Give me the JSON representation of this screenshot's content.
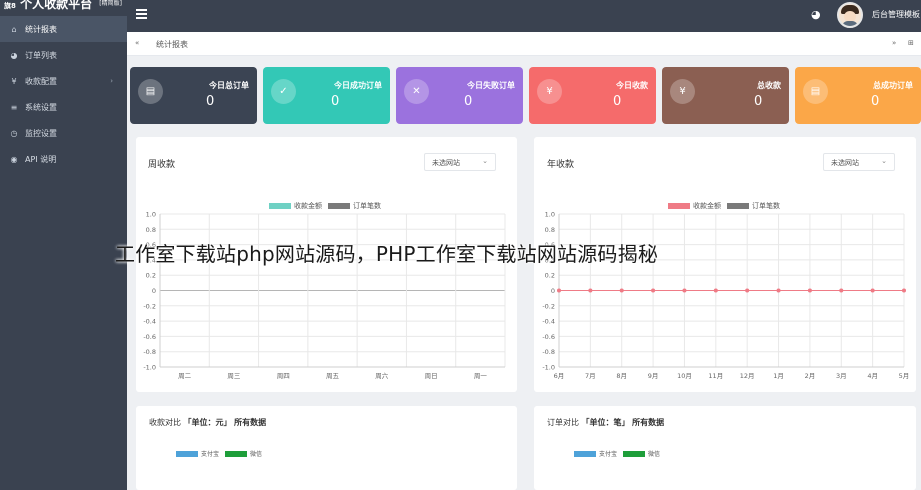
{
  "sidebar": {
    "brand": "个人收款平台",
    "brand_prefix": "旗8",
    "brand_tag": "[精简版]",
    "items": [
      {
        "label": "统计报表",
        "icon": "home-icon"
      },
      {
        "label": "订单列表",
        "icon": "palette-icon"
      },
      {
        "label": "收款配置",
        "icon": "yen-icon"
      },
      {
        "label": "系统设置",
        "icon": "list-icon"
      },
      {
        "label": "监控设置",
        "icon": "clock-icon"
      },
      {
        "label": "API 说明",
        "icon": "eye-icon"
      }
    ]
  },
  "topbar": {
    "user_name": "后台管理模板"
  },
  "tabbar": {
    "current_tab": "统计报表",
    "left_icon": "«",
    "right_icon": "»"
  },
  "cards": [
    {
      "title": "今日总订单",
      "value": "0",
      "color": "#3b4453",
      "icon": "file-icon",
      "glyph": "▤"
    },
    {
      "title": "今日成功订单",
      "value": "0",
      "color": "#33c8b6",
      "icon": "check-icon",
      "glyph": "✓"
    },
    {
      "title": "今日失败订单",
      "value": "0",
      "color": "#9b72de",
      "icon": "close-icon",
      "glyph": "✕"
    },
    {
      "title": "今日收款",
      "value": "0",
      "color": "#f56b6b",
      "icon": "yen-icon",
      "glyph": "¥"
    },
    {
      "title": "总收款",
      "value": "0",
      "color": "#8b5f52",
      "icon": "yen-icon",
      "glyph": "¥"
    },
    {
      "title": "总成功订单",
      "value": "0",
      "color": "#fba748",
      "icon": "file-icon",
      "glyph": "▤"
    }
  ],
  "week_panel": {
    "title": "周收款",
    "select_value": "未选网站",
    "legend": [
      {
        "name": "收款金额",
        "color": "#6fd1c4"
      },
      {
        "name": "订单笔数",
        "color": "#7a7a7a"
      }
    ]
  },
  "year_panel": {
    "title": "年收款",
    "select_value": "未选网站",
    "legend": [
      {
        "name": "收款金额",
        "color": "#ef7b86"
      },
      {
        "name": "订单笔数",
        "color": "#7a7a7a"
      }
    ]
  },
  "income_compare": {
    "title_prefix": "收款对比",
    "title_unit": "「单位：元」",
    "title_suffix": "所有数据",
    "legend": [
      {
        "name": "支付宝",
        "color": "#4ea2d9"
      },
      {
        "name": "微信",
        "color": "#1e9e3a"
      }
    ]
  },
  "order_compare": {
    "title_prefix": "订单对比",
    "title_unit": "「单位：笔」",
    "title_suffix": "所有数据",
    "legend": [
      {
        "name": "支付宝",
        "color": "#4ea2d9"
      },
      {
        "name": "微信",
        "color": "#1e9e3a"
      }
    ]
  },
  "watermark": "工作室下载站php网站源码，PHP工作室下载站网站源码揭秘",
  "chart_data": [
    {
      "type": "line",
      "title": "周收款",
      "categories": [
        "周二",
        "周三",
        "周四",
        "周五",
        "周六",
        "周日",
        "周一"
      ],
      "series": [
        {
          "name": "收款金额",
          "values": [
            0,
            0,
            0,
            0,
            0,
            0,
            0
          ]
        },
        {
          "name": "订单笔数",
          "values": [
            0,
            0,
            0,
            0,
            0,
            0,
            0
          ]
        }
      ],
      "yticks": [
        "1.0",
        "0.8",
        "0.6",
        "0.4",
        "0.2",
        "0",
        "-0.2",
        "-0.4",
        "-0.6",
        "-0.8",
        "-1.0"
      ],
      "ylim": [
        -1,
        1
      ],
      "grid": true,
      "legend": "top"
    },
    {
      "type": "line",
      "title": "年收款",
      "categories": [
        "6月",
        "7月",
        "8月",
        "9月",
        "10月",
        "11月",
        "12月",
        "1月",
        "2月",
        "3月",
        "4月",
        "5月"
      ],
      "series": [
        {
          "name": "收款金额",
          "values": [
            0,
            0,
            0,
            0,
            0,
            0,
            0,
            0,
            0,
            0,
            0,
            0
          ]
        },
        {
          "name": "订单笔数",
          "values": [
            0,
            0,
            0,
            0,
            0,
            0,
            0,
            0,
            0,
            0,
            0,
            0
          ]
        }
      ],
      "yticks": [
        "1.0",
        "0.8",
        "0.6",
        "0.4",
        "0.2",
        "0",
        "-0.2",
        "-0.4",
        "-0.6",
        "-0.8",
        "-1.0"
      ],
      "ylim": [
        -1,
        1
      ],
      "grid": true,
      "legend": "top"
    }
  ]
}
